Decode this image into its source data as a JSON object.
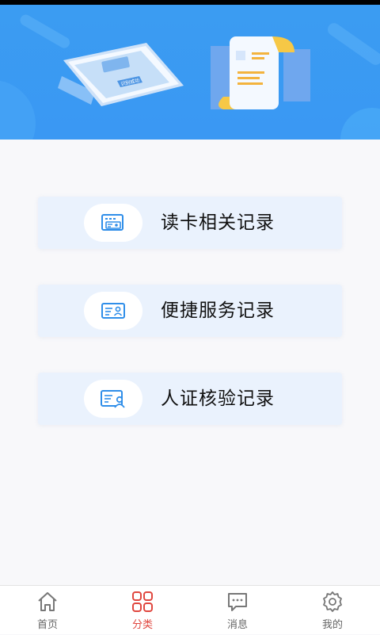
{
  "banner": {
    "phone_badge_text": "识别成功"
  },
  "records": [
    {
      "label": "读卡相关记录",
      "icon": "card-reader-icon"
    },
    {
      "label": "便捷服务记录",
      "icon": "id-card-icon"
    },
    {
      "label": "人证核验记录",
      "icon": "person-verify-icon"
    }
  ],
  "tabbar": {
    "active_index": 1,
    "active_color": "#e0463e",
    "inactive_color": "#666666",
    "items": [
      {
        "label": "首页",
        "icon": "home-icon"
      },
      {
        "label": "分类",
        "icon": "category-icon"
      },
      {
        "label": "消息",
        "icon": "message-icon"
      },
      {
        "label": "我的",
        "icon": "settings-gear-icon"
      }
    ]
  },
  "colors": {
    "banner_blue": "#3a9af3",
    "card_bg": "#eaf2fd",
    "icon_blue": "#2f8ee9"
  }
}
